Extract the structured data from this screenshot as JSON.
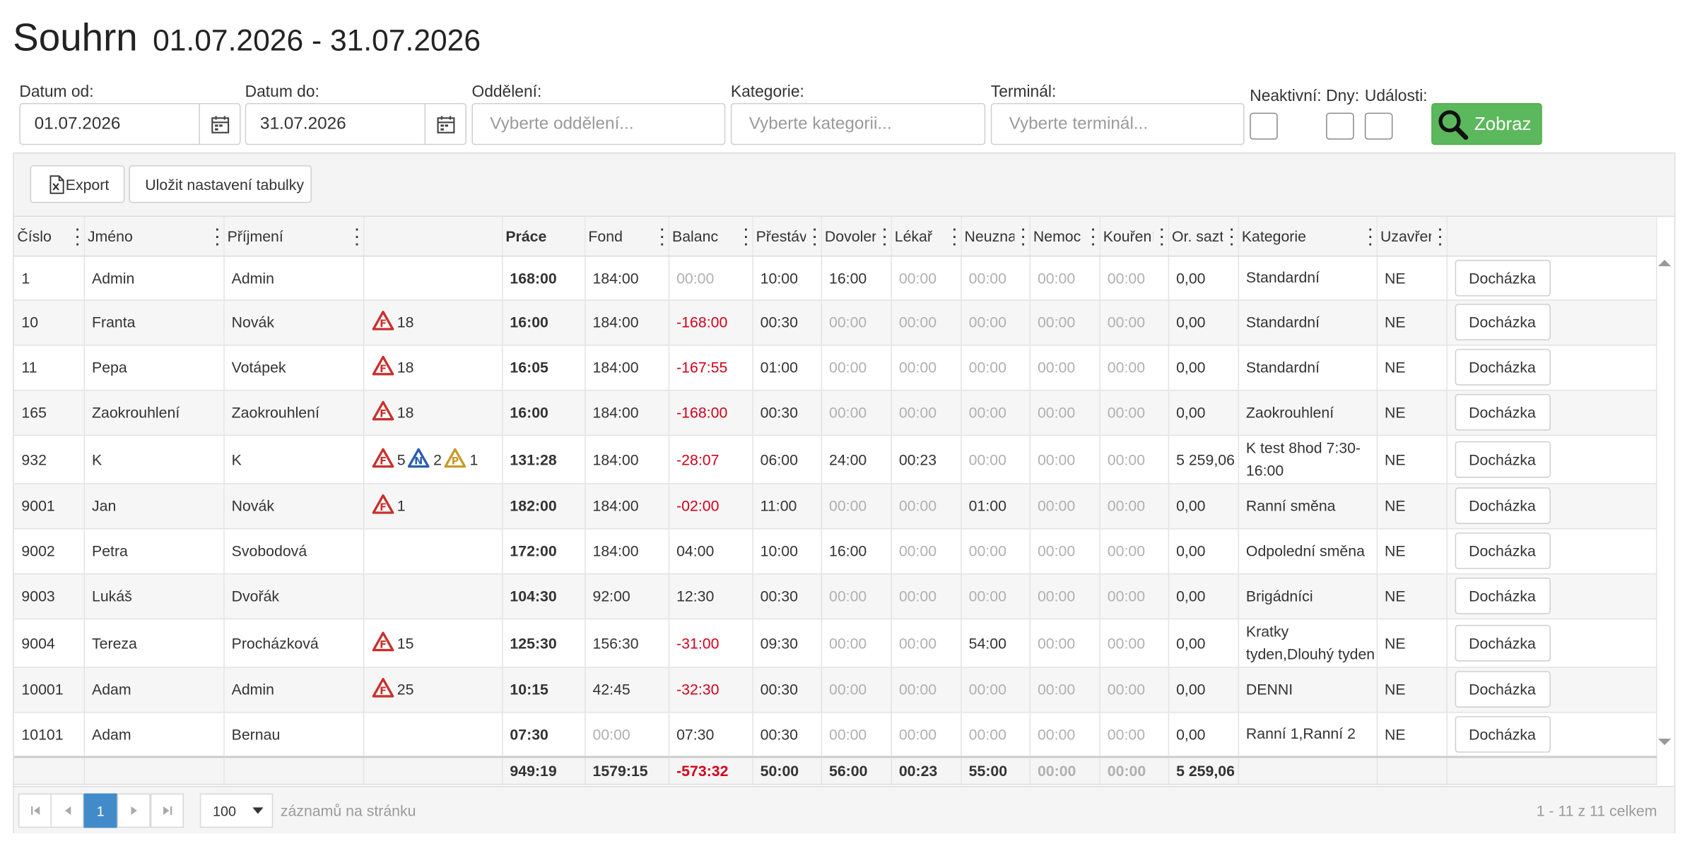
{
  "page": {
    "title": "Souhrn",
    "date_range": "01.07.2026 - 31.07.2026"
  },
  "filters": {
    "date_from_label": "Datum od:",
    "date_from_value": "01.07.2026",
    "date_to_label": "Datum do:",
    "date_to_value": "31.07.2026",
    "department_label": "Oddělení:",
    "department_placeholder": "Vyberte oddělení...",
    "category_label": "Kategorie:",
    "category_placeholder": "Vyberte kategorii...",
    "terminal_label": "Terminál:",
    "terminal_placeholder": "Vyberte terminál...",
    "inactive_label": "Neaktivní:",
    "days_label": "Dny:",
    "events_label": "Události:",
    "show_button": "Zobraz",
    "show_button_color": "#5cb85c"
  },
  "toolbar": {
    "export_label": "Export",
    "save_settings_label": "Uložit nastavení tabulky"
  },
  "table": {
    "headers": [
      "Číslo",
      "Jméno",
      "Příjmení",
      "",
      "Práce",
      "Fond",
      "Balanc",
      "Přestáv",
      "Dovoler",
      "Lékař",
      "Neuzna",
      "Nemoc",
      "Kouření",
      "Or. sazt",
      "Kategorie",
      "Uzavřer",
      ""
    ],
    "action_label": "Docházka",
    "rows": [
      {
        "cislo": "1",
        "jmeno": "Admin",
        "prijmeni": "Admin",
        "events": [],
        "prace": "168:00",
        "fond": "184:00",
        "balanc": "00:00",
        "prestav": "10:00",
        "dovolena": "16:00",
        "lekar": "00:00",
        "neuzna": "00:00",
        "nemoc": "00:00",
        "koureni": "00:00",
        "sazba": "0,00",
        "kategorie": "Standardní",
        "uzavreno": "NE"
      },
      {
        "cislo": "10",
        "jmeno": "Franta",
        "prijmeni": "Novák",
        "events": [
          {
            "type": "F",
            "count": "18"
          }
        ],
        "prace": "16:00",
        "fond": "184:00",
        "balanc": "-168:00",
        "prestav": "00:30",
        "dovolena": "00:00",
        "lekar": "00:00",
        "neuzna": "00:00",
        "nemoc": "00:00",
        "koureni": "00:00",
        "sazba": "0,00",
        "kategorie": "Standardní",
        "uzavreno": "NE"
      },
      {
        "cislo": "11",
        "jmeno": "Pepa",
        "prijmeni": "Votápek",
        "events": [
          {
            "type": "F",
            "count": "18"
          }
        ],
        "prace": "16:05",
        "fond": "184:00",
        "balanc": "-167:55",
        "prestav": "01:00",
        "dovolena": "00:00",
        "lekar": "00:00",
        "neuzna": "00:00",
        "nemoc": "00:00",
        "koureni": "00:00",
        "sazba": "0,00",
        "kategorie": "Standardní",
        "uzavreno": "NE"
      },
      {
        "cislo": "165",
        "jmeno": "Zaokrouhlení",
        "prijmeni": "Zaokrouhlení",
        "events": [
          {
            "type": "F",
            "count": "18"
          }
        ],
        "prace": "16:00",
        "fond": "184:00",
        "balanc": "-168:00",
        "prestav": "00:30",
        "dovolena": "00:00",
        "lekar": "00:00",
        "neuzna": "00:00",
        "nemoc": "00:00",
        "koureni": "00:00",
        "sazba": "0,00",
        "kategorie": "Zaokrouhlení",
        "uzavreno": "NE"
      },
      {
        "cislo": "932",
        "jmeno": "K",
        "prijmeni": "K",
        "events": [
          {
            "type": "F",
            "count": "5"
          },
          {
            "type": "N",
            "count": "2"
          },
          {
            "type": "P",
            "count": "1"
          }
        ],
        "prace": "131:28",
        "fond": "184:00",
        "balanc": "-28:07",
        "prestav": "06:00",
        "dovolena": "24:00",
        "lekar": "00:23",
        "neuzna": "00:00",
        "nemoc": "00:00",
        "koureni": "00:00",
        "sazba": "5 259,06",
        "kategorie": "K test 8hod 7:30-16:00",
        "uzavreno": "NE"
      },
      {
        "cislo": "9001",
        "jmeno": "Jan",
        "prijmeni": "Novák",
        "events": [
          {
            "type": "F",
            "count": "1"
          }
        ],
        "prace": "182:00",
        "fond": "184:00",
        "balanc": "-02:00",
        "prestav": "11:00",
        "dovolena": "00:00",
        "lekar": "00:00",
        "neuzna": "01:00",
        "nemoc": "00:00",
        "koureni": "00:00",
        "sazba": "0,00",
        "kategorie": "Ranní směna",
        "uzavreno": "NE"
      },
      {
        "cislo": "9002",
        "jmeno": "Petra",
        "prijmeni": "Svobodová",
        "events": [],
        "prace": "172:00",
        "fond": "184:00",
        "balanc": "04:00",
        "prestav": "10:00",
        "dovolena": "16:00",
        "lekar": "00:00",
        "neuzna": "00:00",
        "nemoc": "00:00",
        "koureni": "00:00",
        "sazba": "0,00",
        "kategorie": "Odpolední směna",
        "uzavreno": "NE"
      },
      {
        "cislo": "9003",
        "jmeno": "Lukáš",
        "prijmeni": "Dvořák",
        "events": [],
        "prace": "104:30",
        "fond": "92:00",
        "balanc": "12:30",
        "prestav": "00:30",
        "dovolena": "00:00",
        "lekar": "00:00",
        "neuzna": "00:00",
        "nemoc": "00:00",
        "koureni": "00:00",
        "sazba": "0,00",
        "kategorie": "Brigádníci",
        "uzavreno": "NE"
      },
      {
        "cislo": "9004",
        "jmeno": "Tereza",
        "prijmeni": "Procházková",
        "events": [
          {
            "type": "F",
            "count": "15"
          }
        ],
        "prace": "125:30",
        "fond": "156:30",
        "balanc": "-31:00",
        "prestav": "09:30",
        "dovolena": "00:00",
        "lekar": "00:00",
        "neuzna": "54:00",
        "nemoc": "00:00",
        "koureni": "00:00",
        "sazba": "0,00",
        "kategorie": "Kratky tyden,Dlouhý tyden",
        "uzavreno": "NE"
      },
      {
        "cislo": "10001",
        "jmeno": "Adam",
        "prijmeni": "Admin",
        "events": [
          {
            "type": "F",
            "count": "25"
          }
        ],
        "prace": "10:15",
        "fond": "42:45",
        "balanc": "-32:30",
        "prestav": "00:30",
        "dovolena": "00:00",
        "lekar": "00:00",
        "neuzna": "00:00",
        "nemoc": "00:00",
        "koureni": "00:00",
        "sazba": "0,00",
        "kategorie": "DENNI",
        "uzavreno": "NE"
      },
      {
        "cislo": "10101",
        "jmeno": "Adam",
        "prijmeni": "Bernau",
        "events": [],
        "prace": "07:30",
        "fond": "00:00",
        "balanc": "07:30",
        "prestav": "00:30",
        "dovolena": "00:00",
        "lekar": "00:00",
        "neuzna": "00:00",
        "nemoc": "00:00",
        "koureni": "00:00",
        "sazba": "0,00",
        "kategorie": "Ranní 1,Ranní 2",
        "uzavreno": "NE"
      }
    ],
    "totals": {
      "prace": "949:19",
      "fond": "1579:15",
      "balanc": "-573:32",
      "prestav": "50:00",
      "dovolena": "56:00",
      "lekar": "00:23",
      "neuzna": "55:00",
      "nemoc": "00:00",
      "koureni": "00:00",
      "sazba": "5 259,06"
    }
  },
  "pager": {
    "current_page": "1",
    "page_size": "100",
    "per_page_label": "záznamů na stránku",
    "summary": "1 - 11 z 11 celkem",
    "active_color": "#428bca"
  },
  "event_colors": {
    "F": "#c9302c",
    "N": "#2a5db0",
    "P": "#c99a2c"
  }
}
